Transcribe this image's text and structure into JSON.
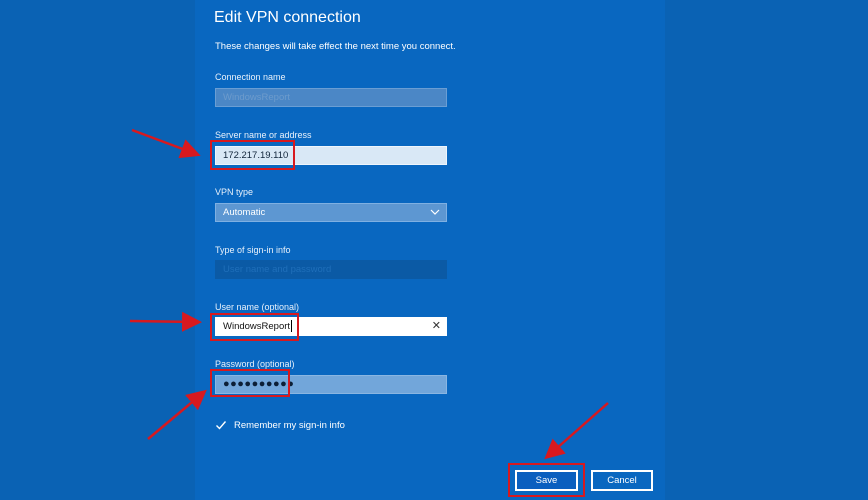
{
  "dialog": {
    "title": "Edit VPN connection",
    "subtitle": "These changes will take effect the next time you connect."
  },
  "fields": {
    "connection_name": {
      "label": "Connection name",
      "value": "WindowsReport"
    },
    "server": {
      "label": "Server name or address",
      "value": "172.217.19.110"
    },
    "vpn_type": {
      "label": "VPN type",
      "value": "Automatic"
    },
    "signin_type": {
      "label": "Type of sign-in info",
      "value": "User name and password"
    },
    "username": {
      "label": "User name (optional)",
      "value": "WindowsReport"
    },
    "password": {
      "label": "Password (optional)",
      "value": "●●●●●●●●●●"
    }
  },
  "remember": {
    "label": "Remember my sign-in info",
    "checked": true
  },
  "buttons": {
    "save": "Save",
    "cancel": "Cancel"
  },
  "colors": {
    "background": "#0a62b4",
    "highlight": "#d7191f",
    "text": "#ffffff"
  },
  "icons": {
    "dropdown": "chevron-down-icon",
    "clear": "close-icon",
    "check": "checkmark-icon",
    "annotation": "red-arrow-icon"
  }
}
